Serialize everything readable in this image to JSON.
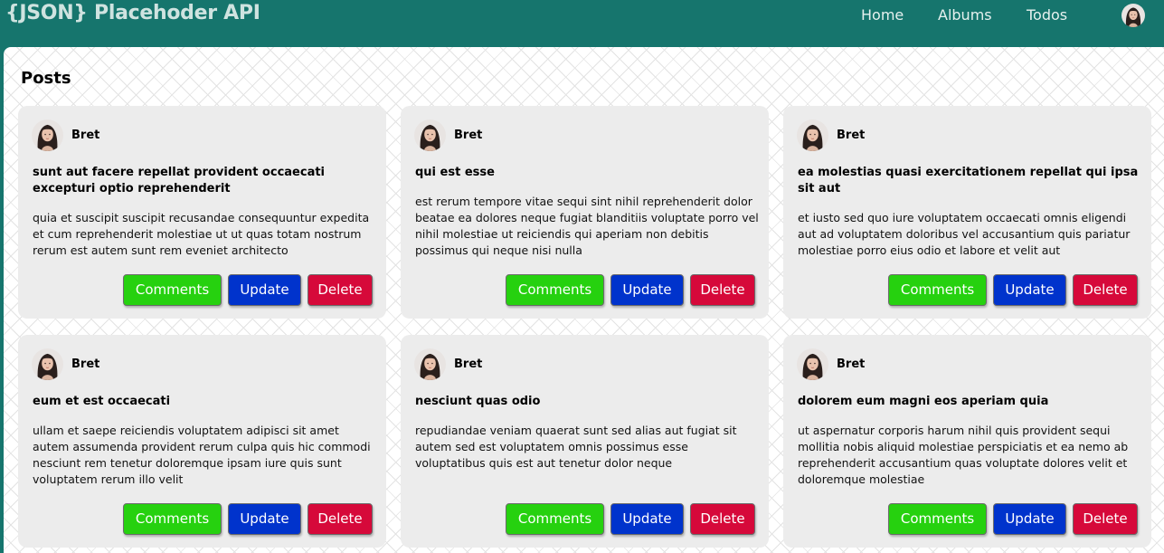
{
  "navbar": {
    "brand": "{JSON} Placehoder API",
    "links": [
      "Home",
      "Albums",
      "Todos"
    ]
  },
  "main": {
    "heading": "Posts"
  },
  "buttons": {
    "comments": "Comments",
    "update": "Update",
    "delete": "Delete"
  },
  "colors": {
    "header": "#16756d",
    "card": "#ececec",
    "comments_button": "#26d10f",
    "update_button": "#0033cc",
    "delete_button": "#d6093a"
  },
  "posts": [
    {
      "author": "Bret",
      "title": "sunt aut facere repellat provident occaecati excepturi optio reprehenderit",
      "body": "quia et suscipit suscipit recusandae consequuntur expedita et cum reprehenderit molestiae ut ut quas totam nostrum rerum est autem sunt rem eveniet architecto"
    },
    {
      "author": "Bret",
      "title": "qui est esse",
      "body": "est rerum tempore vitae sequi sint nihil reprehenderit dolor beatae ea dolores neque fugiat blanditiis voluptate porro vel nihil molestiae ut reiciendis qui aperiam non debitis possimus qui neque nisi nulla"
    },
    {
      "author": "Bret",
      "title": "ea molestias quasi exercitationem repellat qui ipsa sit aut",
      "body": "et iusto sed quo iure voluptatem occaecati omnis eligendi aut ad voluptatem doloribus vel accusantium quis pariatur molestiae porro eius odio et labore et velit aut"
    },
    {
      "author": "Bret",
      "title": "eum et est occaecati",
      "body": "ullam et saepe reiciendis voluptatem adipisci sit amet autem assumenda provident rerum culpa quis hic commodi nesciunt rem tenetur doloremque ipsam iure quis sunt voluptatem rerum illo velit"
    },
    {
      "author": "Bret",
      "title": "nesciunt quas odio",
      "body": "repudiandae veniam quaerat sunt sed alias aut fugiat sit autem sed est voluptatem omnis possimus esse voluptatibus quis est aut tenetur dolor neque"
    },
    {
      "author": "Bret",
      "title": "dolorem eum magni eos aperiam quia",
      "body": "ut aspernatur corporis harum nihil quis provident sequi mollitia nobis aliquid molestiae perspiciatis et ea nemo ab reprehenderit accusantium quas voluptate dolores velit et doloremque molestiae"
    }
  ]
}
